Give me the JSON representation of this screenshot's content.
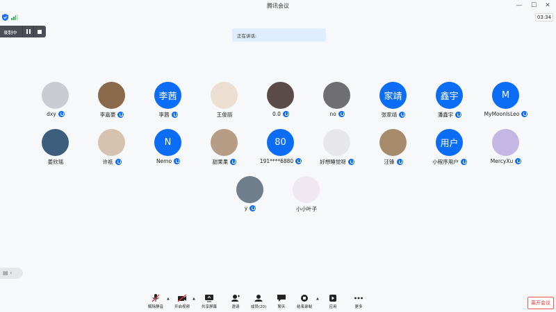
{
  "window": {
    "title": "腾讯会议"
  },
  "status": {
    "timer": "03:34"
  },
  "recording": {
    "label": "录制中"
  },
  "speaking": {
    "label": "正在讲话:"
  },
  "participants": [
    {
      "name": "dxy",
      "avatar_type": "photo",
      "avatar_text": "",
      "mic": "on"
    },
    {
      "name": "李嘉豪",
      "avatar_type": "photo",
      "avatar_text": "",
      "mic": "on"
    },
    {
      "name": "李茜",
      "avatar_type": "blue",
      "avatar_text": "李茜",
      "mic": "on"
    },
    {
      "name": "王俊丽",
      "avatar_type": "photo",
      "avatar_text": "",
      "mic": "none"
    },
    {
      "name": "0.0",
      "avatar_type": "photo",
      "avatar_text": "",
      "mic": "on"
    },
    {
      "name": "no",
      "avatar_type": "photo",
      "avatar_text": "",
      "mic": "on"
    },
    {
      "name": "张家靖",
      "avatar_type": "blue",
      "avatar_text": "家靖",
      "mic": "on"
    },
    {
      "name": "潘鑫宇",
      "avatar_type": "blue",
      "avatar_text": "鑫宇",
      "mic": "on"
    },
    {
      "name": "MyMoonIsLeo",
      "avatar_type": "blue",
      "avatar_text": "M",
      "mic": "on"
    },
    {
      "name": "姜欣瑶",
      "avatar_type": "photo",
      "avatar_text": "",
      "mic": "none"
    },
    {
      "name": "许祇",
      "avatar_type": "photo",
      "avatar_text": "",
      "mic": "on"
    },
    {
      "name": "Nemo",
      "avatar_type": "blue",
      "avatar_text": "N",
      "mic": "on"
    },
    {
      "name": "甜果果",
      "avatar_type": "photo",
      "avatar_text": "",
      "mic": "on"
    },
    {
      "name": "191****6880",
      "avatar_type": "blue",
      "avatar_text": "80",
      "mic": "on"
    },
    {
      "name": "好想睡觉呀",
      "avatar_type": "photo",
      "avatar_text": "",
      "mic": "on"
    },
    {
      "name": "汪锋",
      "avatar_type": "photo",
      "avatar_text": "",
      "mic": "on"
    },
    {
      "name": "小程序用户",
      "avatar_type": "blue",
      "avatar_text": "用户",
      "mic": "on"
    },
    {
      "name": "MercyXu",
      "avatar_type": "photo",
      "avatar_text": "",
      "mic": "on"
    },
    {
      "name": "y",
      "avatar_type": "photo",
      "avatar_text": "",
      "mic": "on"
    },
    {
      "name": "小小叶子",
      "avatar_type": "photo",
      "avatar_text": "",
      "mic": "none"
    }
  ],
  "toolbar": {
    "unmute": "解除静音",
    "start_video": "开启视频",
    "share_screen": "共享屏幕",
    "invite": "邀请",
    "members": "成员(20)",
    "chat": "聊天",
    "end_recording": "结束录制",
    "apps": "应用",
    "more": "更多",
    "leave": "离开会议"
  },
  "colors": {
    "accent": "#0b6cf6",
    "danger": "#e33333",
    "speaking_bg": "#dfeefe",
    "recording_bg": "#4b4e57"
  }
}
